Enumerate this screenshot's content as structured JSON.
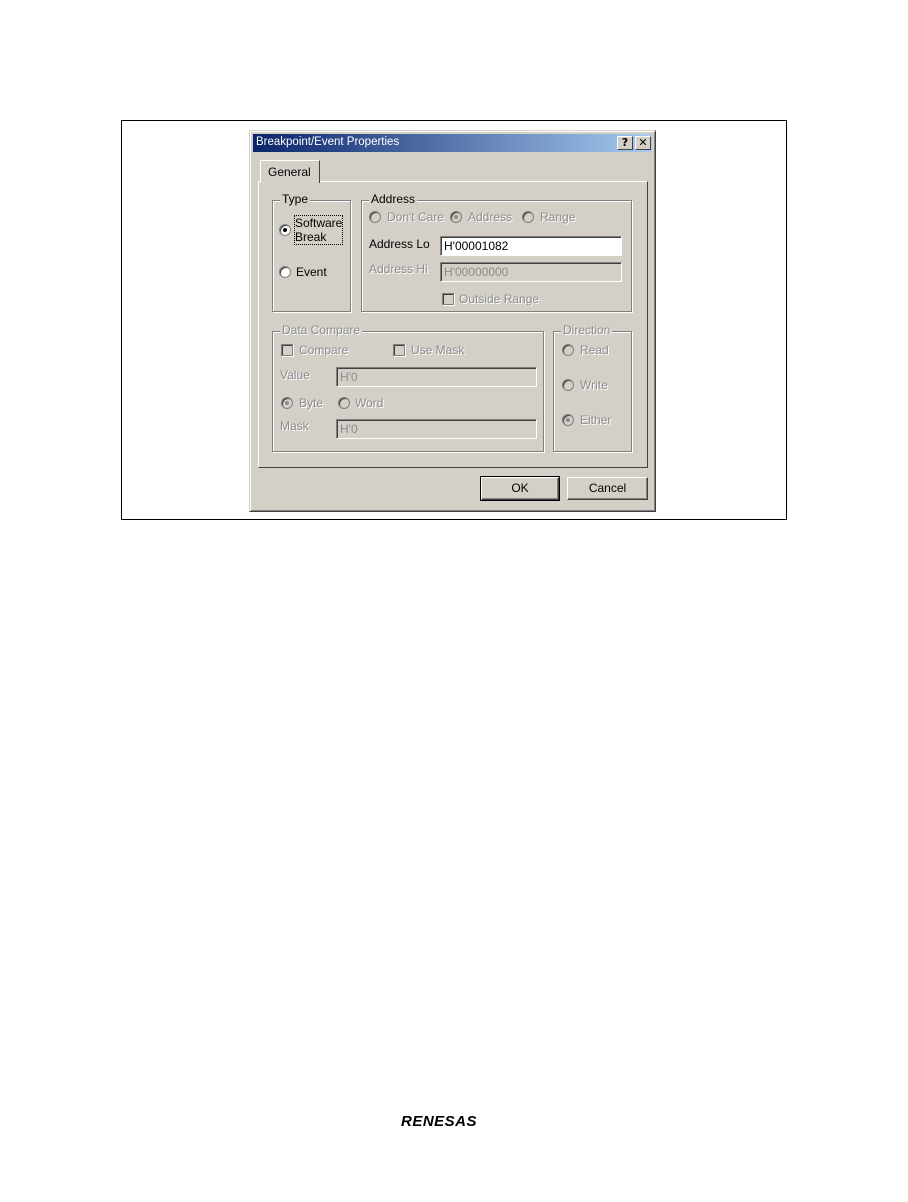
{
  "dialog": {
    "title": "Breakpoint/Event Properties",
    "help_label": "?",
    "close_label": "✕"
  },
  "tabs": [
    {
      "label": "General",
      "selected": true
    }
  ],
  "type_group": {
    "label": "Type",
    "software_break_line1": "Software",
    "software_break_line2": "Break",
    "software_break_selected": true,
    "event_label": "Event"
  },
  "address_group": {
    "label": "Address",
    "option_dont_care": "Don't Care",
    "option_address": "Address",
    "option_range": "Range",
    "selected_option": "Address",
    "address_lo_label": "Address Lo",
    "address_lo_value": "H'00001082",
    "address_hi_label": "Address Hi",
    "address_hi_value": "H'00000000",
    "outside_range_label": "Outside Range"
  },
  "data_compare_group": {
    "label": "Data Compare",
    "compare_label": "Compare",
    "use_mask_label": "Use Mask",
    "value_label": "Value",
    "value_value": "H'0",
    "byte_label": "Byte",
    "word_label": "Word",
    "selected_size": "Byte",
    "mask_label": "Mask",
    "mask_value": "H'0"
  },
  "direction_group": {
    "label": "Direction",
    "read_label": "Read",
    "write_label": "Write",
    "either_label": "Either",
    "selected": "Either"
  },
  "buttons": {
    "ok": "OK",
    "cancel": "Cancel"
  },
  "footer": {
    "brand": "RENESAS"
  },
  "colors": {
    "titlebar_start": "#0a246a",
    "titlebar_end": "#a6caf0",
    "face": "#d4d0c8"
  }
}
